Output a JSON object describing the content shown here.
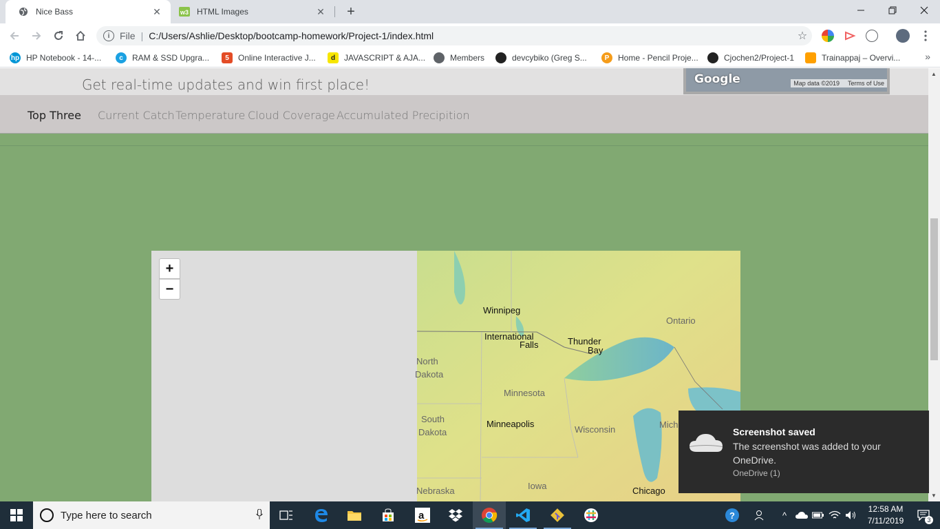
{
  "browser": {
    "tabs": [
      {
        "title": "Nice Bass",
        "icon": "globe-icon",
        "active": true
      },
      {
        "title": "HTML Images",
        "icon": "w3schools-icon",
        "active": false
      }
    ],
    "address": {
      "scheme": "File",
      "url": "C:/Users/Ashlie/Desktop/bootcamp-homework/Project-1/index.html"
    },
    "bookmarks": [
      {
        "label": "HP Notebook - 14-...",
        "icon": "hp-icon",
        "color": "#0096d6"
      },
      {
        "label": "RAM & SSD Upgra...",
        "icon": "crucial-icon",
        "color": "#1ba1e2"
      },
      {
        "label": "Online Interactive J...",
        "icon": "html5-icon",
        "color": "#e34c26"
      },
      {
        "label": "JAVASCRIPT & AJA...",
        "icon": "d-icon",
        "color": "#f7e600"
      },
      {
        "label": "Members",
        "icon": "globe-icon",
        "color": "#5f6368"
      },
      {
        "label": "devcybiko (Greg S...",
        "icon": "github-icon",
        "color": "#222222"
      },
      {
        "label": "Home - Pencil Proje...",
        "icon": "pencil-icon",
        "color": "#f59c1a"
      },
      {
        "label": "Cjochen2/Project-1",
        "icon": "github-icon",
        "color": "#222222"
      },
      {
        "label": "Trainappaj – Overvi...",
        "icon": "firebase-icon",
        "color": "#ffa000"
      }
    ]
  },
  "page": {
    "tagline": "Get real-time updates and win first place!",
    "mini_map": {
      "logo": "Google",
      "attribution": "Map data ©2019",
      "terms": "Terms of Use"
    },
    "nav": [
      "Top Three",
      "Current Catch",
      "Temperature",
      "Cloud Coverage",
      "Accumulated Precipition"
    ],
    "map": {
      "zoom_in": "+",
      "zoom_out": "−",
      "labels": {
        "winnipeg": "Winnipeg",
        "ontario": "Ontario",
        "intl_falls_1": "International",
        "intl_falls_2": "Falls",
        "thunder_bay_1": "Thunder",
        "thunder_bay_2": "Bay",
        "north_dakota_1": "North",
        "north_dakota_2": "Dakota",
        "minnesota": "Minnesota",
        "south_dakota_1": "South",
        "south_dakota_2": "Dakota",
        "minneapolis": "Minneapolis",
        "wisconsin": "Wisconsin",
        "michigan": "Mich",
        "nebraska": "Nebraska",
        "iowa": "Iowa",
        "chicago": "Chicago"
      }
    }
  },
  "toast": {
    "title": "Screenshot saved",
    "body": "The screenshot was added to your OneDrive.",
    "source": "OneDrive (1)"
  },
  "taskbar": {
    "search_placeholder": "Type here to search",
    "time": "12:58 AM",
    "date": "7/11/2019",
    "notification_count": "3"
  }
}
